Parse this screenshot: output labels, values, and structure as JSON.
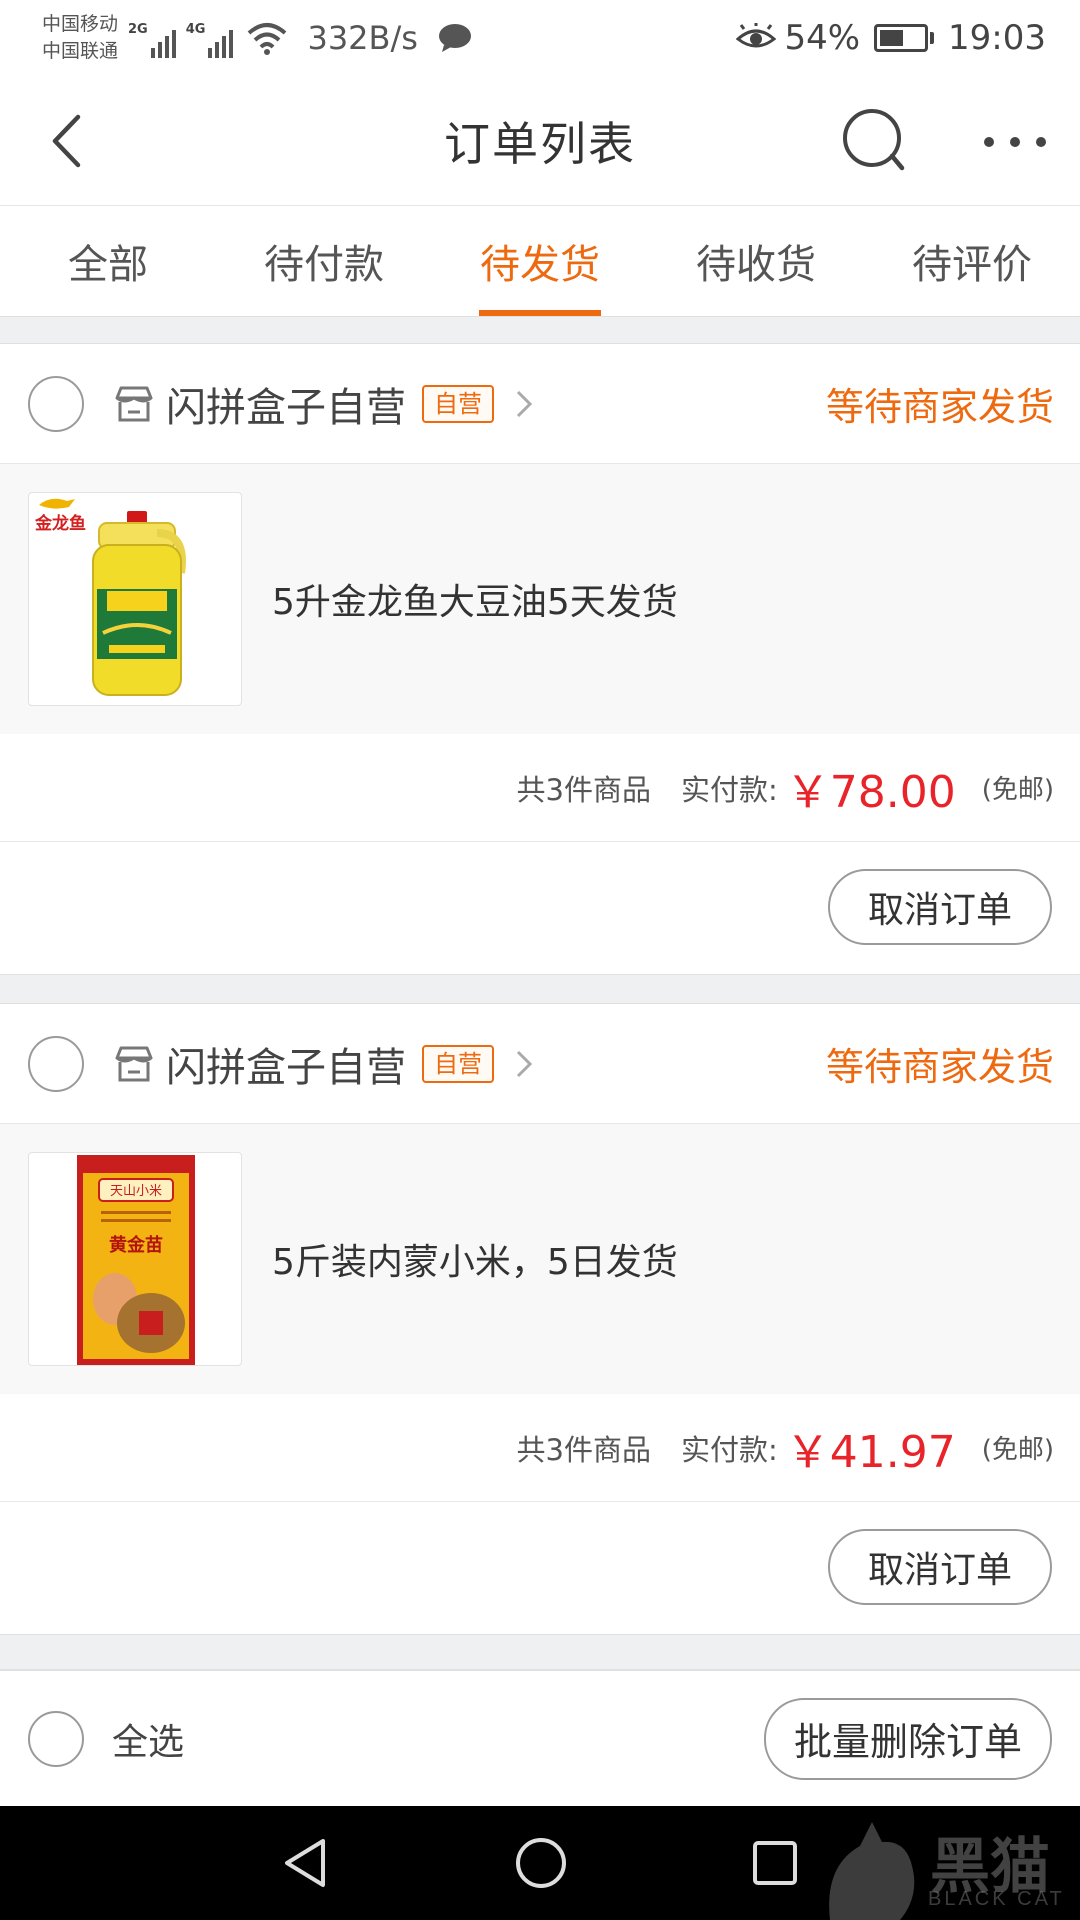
{
  "status_bar": {
    "carrier_1": "中国移动",
    "carrier_2": "中国联通",
    "net_1": "2G",
    "net_2": "4G",
    "speed": "332B/s",
    "battery": "54%",
    "battery_level": 0.54,
    "time": "19:03"
  },
  "header": {
    "title": "订单列表"
  },
  "tabs": [
    {
      "label": "全部",
      "active": false
    },
    {
      "label": "待付款",
      "active": false
    },
    {
      "label": "待发货",
      "active": true
    },
    {
      "label": "待收货",
      "active": false
    },
    {
      "label": "待评价",
      "active": false
    }
  ],
  "orders": [
    {
      "shop_name": "闪拼盒子自营",
      "badge": "自营",
      "status": "等待商家发货",
      "item_title": "5升金龙鱼大豆油5天发货",
      "thumb_brand": "金龙鱼",
      "count_text": "共3件商品",
      "paid_label": "实付款:",
      "price": "￥78.00",
      "shipping": "(免邮)",
      "action": "取消订单"
    },
    {
      "shop_name": "闪拼盒子自营",
      "badge": "自营",
      "status": "等待商家发货",
      "item_title": "5斤装内蒙小米，5日发货",
      "thumb_brand": "天山小米",
      "thumb_name": "黄金苗",
      "count_text": "共3件商品",
      "paid_label": "实付款:",
      "price": "￥41.97",
      "shipping": "(免邮)",
      "action": "取消订单"
    }
  ],
  "footer": {
    "select_all": "全选",
    "batch_delete": "批量删除订单"
  },
  "watermark": {
    "text": "黑猫",
    "sub": "BLACK CAT"
  },
  "colors": {
    "accent": "#ee6a10",
    "price": "#e8232a"
  }
}
